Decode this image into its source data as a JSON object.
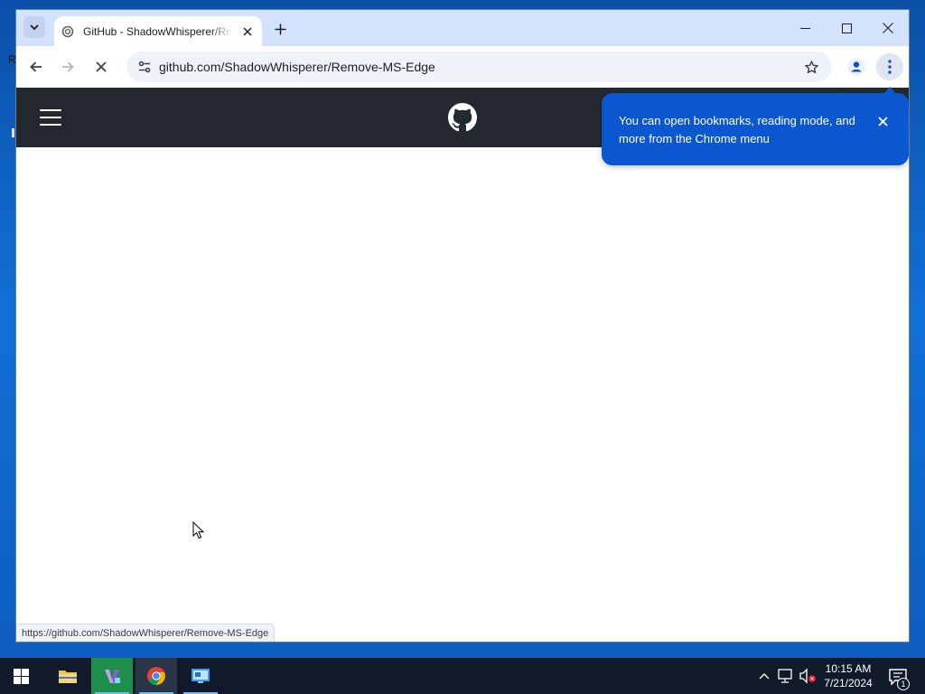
{
  "browser": {
    "tab": {
      "title": "GitHub - ShadowWhisperer/Remove-MS-Edge"
    },
    "omnibox": {
      "url": "github.com/ShadowWhisperer/Remove-MS-Edge"
    },
    "status_bar": {
      "hover_url": "https://github.com/ShadowWhisperer/Remove-MS-Edge"
    },
    "menu_tip": {
      "text": "You can open bookmarks, reading mode, and more from the Chrome menu"
    }
  },
  "desktop": {
    "edge_glyph": "R"
  },
  "taskbar": {
    "apps": [
      "start-icon",
      "file-explorer-icon",
      "visual-studio-icon",
      "chrome-icon",
      "remote-desktop-icon"
    ],
    "clock": {
      "time": "10:15 AM",
      "date": "7/21/2024"
    },
    "notification_count": "1"
  },
  "colors": {
    "chrome_tabstrip": "#d3e3fd",
    "github_header": "#24292f",
    "tip_bubble": "#0b57d0",
    "taskbar": "#101a2b"
  }
}
